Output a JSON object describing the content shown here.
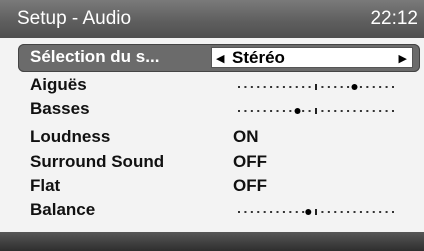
{
  "header": {
    "title": "Setup - Audio",
    "clock": "22:12"
  },
  "menu": {
    "selected": {
      "label": "Sélection du s...",
      "value": "Stéréo"
    },
    "items": [
      {
        "label": "Aiguës",
        "type": "slider",
        "level": 0.75
      },
      {
        "label": "Basses",
        "type": "slider",
        "level": 0.38
      },
      {
        "label": "Loudness",
        "type": "value",
        "value": "ON"
      },
      {
        "label": "Surround Sound",
        "type": "value",
        "value": "OFF"
      },
      {
        "label": "Flat",
        "type": "value",
        "value": "OFF"
      },
      {
        "label": "Balance",
        "type": "slider",
        "level": 0.45
      }
    ]
  },
  "icons": {
    "left_arrow": "left-triangle",
    "right_arrow": "right-triangle"
  },
  "colors": {
    "header_bg": "#6a6a6a",
    "panel_bg": "#f3f3f3",
    "selected_bg": "#6b6b6b"
  }
}
